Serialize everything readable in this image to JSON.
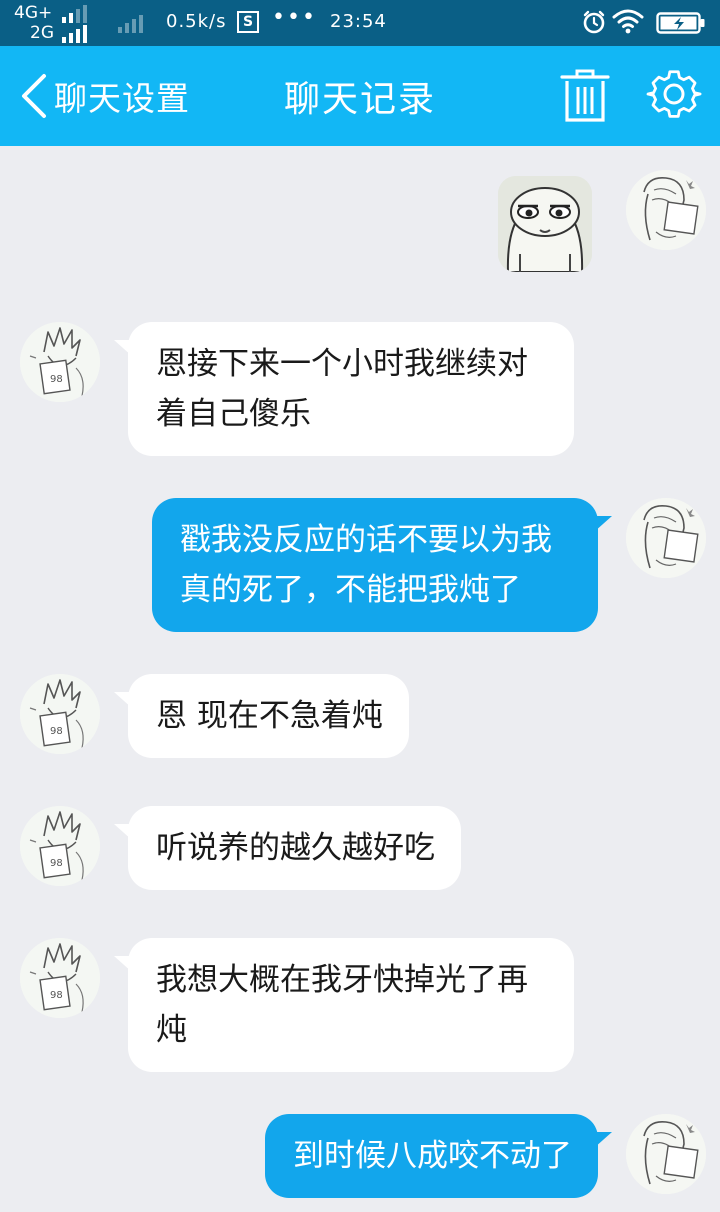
{
  "status_bar": {
    "network_top": "4G+",
    "network_bottom": "2G",
    "speed": "0.5k/s",
    "sim_badge": "S",
    "overflow": "•••",
    "time": "23:54",
    "icons": [
      "signal-icon",
      "alarm-icon",
      "wifi-icon",
      "battery-charging-icon"
    ]
  },
  "header": {
    "back_label": "聊天设置",
    "title": "聊天记录",
    "actions": [
      "trash-icon",
      "gear-icon"
    ]
  },
  "colors": {
    "status_bar": "#0a5f86",
    "header": "#12b7f5",
    "background": "#ecedf1",
    "outgoing_bubble": "#12a6ec",
    "incoming_bubble": "#ffffff"
  },
  "messages": [
    {
      "direction": "outgoing",
      "type": "sticker",
      "text": ""
    },
    {
      "direction": "incoming",
      "type": "text",
      "text": "恩接下来一个小时我继续对着自己傻乐"
    },
    {
      "direction": "outgoing",
      "type": "text",
      "text": "戳我没反应的话不要以为我真的死了，不能把我炖了"
    },
    {
      "direction": "incoming",
      "type": "text",
      "text": "恩 现在不急着炖"
    },
    {
      "direction": "incoming",
      "type": "text",
      "text": "听说养的越久越好吃"
    },
    {
      "direction": "incoming",
      "type": "text",
      "text": "我想大概在我牙快掉光了再炖"
    },
    {
      "direction": "outgoing",
      "type": "text",
      "text": "到时候八成咬不动了"
    }
  ]
}
